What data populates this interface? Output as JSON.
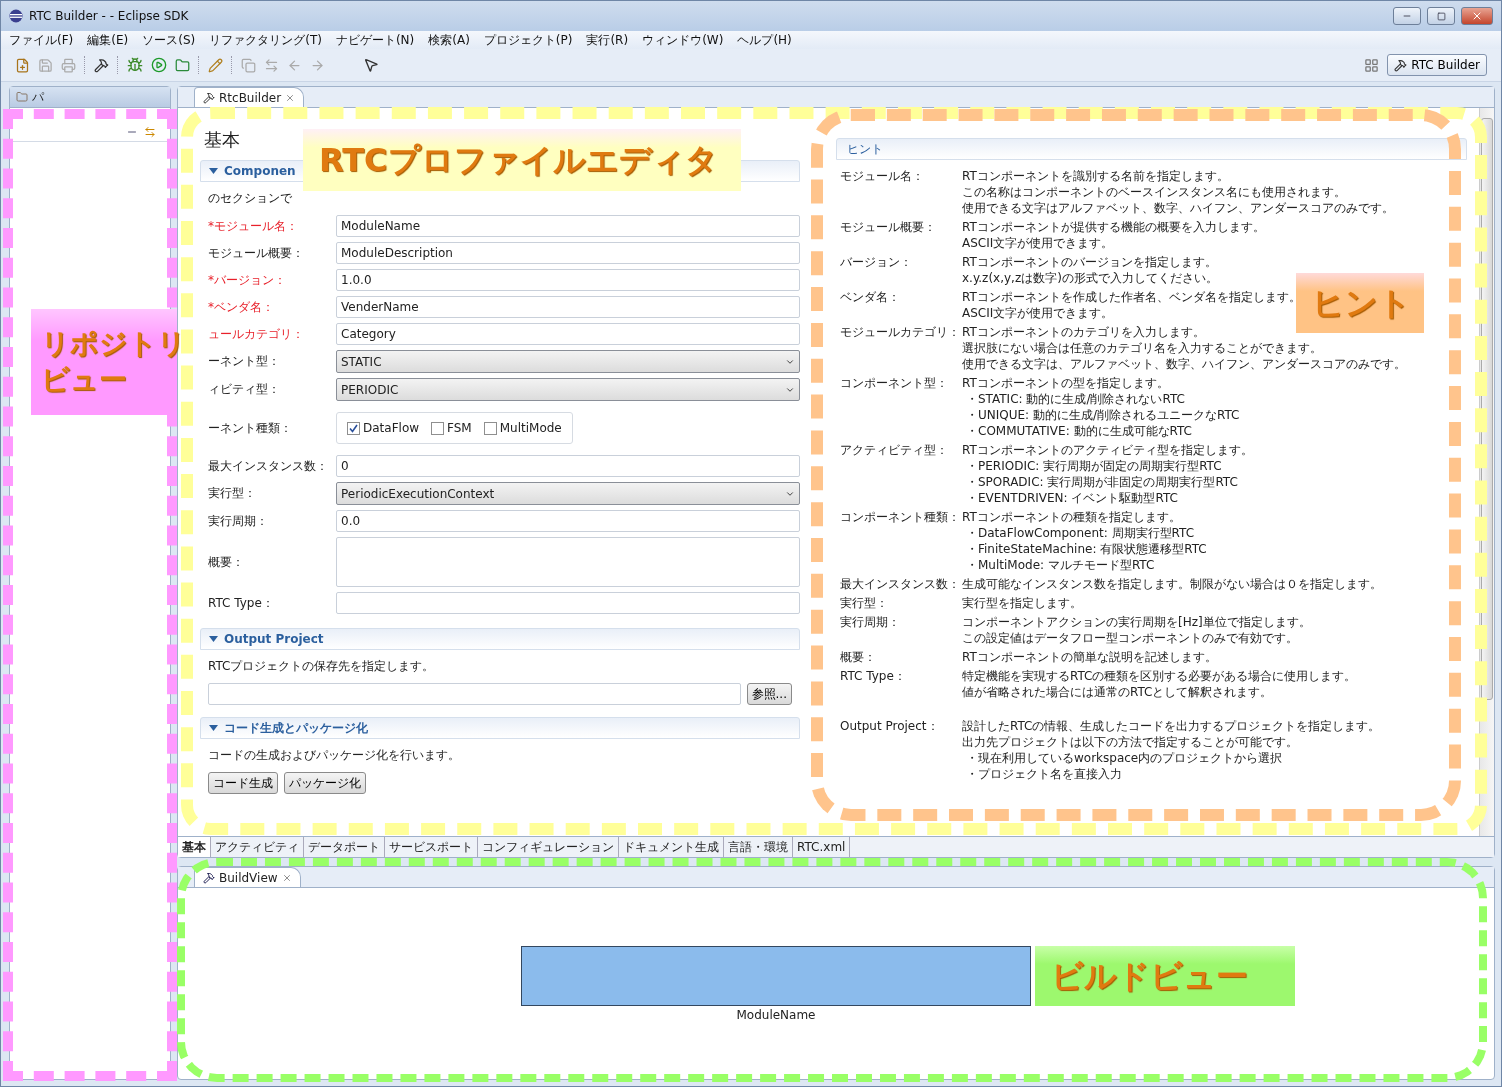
{
  "window": {
    "title": "RTC Builder -  - Eclipse SDK"
  },
  "menu": [
    "ファイル(F)",
    "編集(E)",
    "ソース(S)",
    "リファクタリング(T)",
    "ナビゲート(N)",
    "検索(A)",
    "プロジェクト(P)",
    "実行(R)",
    "ウィンドウ(W)",
    "ヘルプ(H)"
  ],
  "perspective": {
    "label": "RTC Builder"
  },
  "left_panel": {
    "tab": "パ"
  },
  "editor": {
    "tab": "RtcBuilder",
    "page_title": "基本",
    "basic_section": {
      "title": "Componen",
      "description": "のセクションで",
      "fields": [
        {
          "label": "*モジュール名：",
          "required": true,
          "kind": "text",
          "value": "ModuleName"
        },
        {
          "label": "モジュール概要：",
          "required": false,
          "kind": "text",
          "value": "ModuleDescription"
        },
        {
          "label": "*バージョン：",
          "required": true,
          "kind": "text",
          "value": "1.0.0"
        },
        {
          "label": "*ベンダ名：",
          "required": true,
          "kind": "text",
          "value": "VenderName"
        },
        {
          "label": "ュールカテゴリ：",
          "required": true,
          "kind": "text",
          "value": "Category"
        },
        {
          "label": "ーネント型：",
          "required": false,
          "kind": "combo",
          "value": "STATIC"
        },
        {
          "label": "ィビティ型：",
          "required": false,
          "kind": "combo",
          "value": "PERIODIC"
        },
        {
          "label": "ーネント種類：",
          "required": false,
          "kind": "checks",
          "options": [
            {
              "label": "DataFlow",
              "checked": true
            },
            {
              "label": "FSM",
              "checked": false
            },
            {
              "label": "MultiMode",
              "checked": false
            }
          ]
        },
        {
          "label": "最大インスタンス数：",
          "required": false,
          "kind": "text",
          "value": "0"
        },
        {
          "label": "実行型：",
          "required": false,
          "kind": "combo",
          "value": "PeriodicExecutionContext"
        },
        {
          "label": "実行周期：",
          "required": false,
          "kind": "text",
          "value": "0.0"
        },
        {
          "label": "概要：",
          "required": false,
          "kind": "textarea"
        },
        {
          "label": "RTC Type：",
          "required": false,
          "kind": "text"
        }
      ]
    },
    "output_section": {
      "title": "Output Project",
      "description": "RTCプロジェクトの保存先を指定します。",
      "browse_button": "参照..."
    },
    "codegen_section": {
      "title": "コード生成とパッケージ化",
      "description": "コードの生成およびパッケージ化を行います。",
      "buttons": [
        "コード生成",
        "パッケージ化"
      ]
    },
    "bottom_tabs": [
      {
        "label": "基本",
        "selected": true
      },
      {
        "label": "アクティビティ",
        "selected": false
      },
      {
        "label": "データポート",
        "selected": false
      },
      {
        "label": "サービスポート",
        "selected": false
      },
      {
        "label": "コンフィギュレーション",
        "selected": false
      },
      {
        "label": "ドキュメント生成",
        "selected": false
      },
      {
        "label": "言語・環境",
        "selected": false
      },
      {
        "label": "RTC.xml",
        "selected": false
      }
    ]
  },
  "hints": {
    "title": "ヒント",
    "items": [
      {
        "label": "モジュール名：",
        "lines": [
          "RTコンポーネントを識別する名前を指定します。",
          "この名称はコンポーネントのベースインスタンス名にも使用されます。",
          "使用できる文字はアルファベット、数字、ハイフン、アンダースコアのみです。"
        ]
      },
      {
        "label": "モジュール概要：",
        "lines": [
          "RTコンポーネントが提供する機能の概要を入力します。",
          "ASCII文字が使用できます。"
        ]
      },
      {
        "label": "バージョン：",
        "lines": [
          "RTコンポーネントのバージョンを指定します。",
          "x.y.z(x,y,zは数字)の形式で入力してください。"
        ]
      },
      {
        "label": "ベンダ名：",
        "lines": [
          "RTコンポーネントを作成した作者名、ベンダ名を指定します。",
          "ASCII文字が使用できます。"
        ]
      },
      {
        "label": "モジュールカテゴリ：",
        "lines": [
          "RTコンポーネントのカテゴリを入力します。",
          "選択肢にない場合は任意のカテゴリ名を入力することができます。",
          "使用できる文字は、アルファベット、数字、ハイフン、アンダースコアのみです。"
        ]
      },
      {
        "label": "コンポーネント型：",
        "lines": [
          "RTコンポーネントの型を指定します。",
          "・STATIC: 動的に生成/削除されないRTC",
          "・UNIQUE: 動的に生成/削除されるユニークなRTC",
          "・COMMUTATIVE: 動的に生成可能なRTC"
        ]
      },
      {
        "label": "アクティビティ型：",
        "lines": [
          "RTコンポーネントのアクティビティ型を指定します。",
          "・PERIODIC: 実行周期が固定の周期実行型RTC",
          "・SPORADIC: 実行周期が非固定の周期実行型RTC",
          "・EVENTDRIVEN: イベント駆動型RTC"
        ]
      },
      {
        "label": "コンポーネント種類：",
        "lines": [
          "RTコンポーネントの種類を指定します。",
          "・DataFlowComponent: 周期実行型RTC",
          "・FiniteStateMachine: 有限状態遷移型RTC",
          "・MultiMode: マルチモード型RTC"
        ]
      },
      {
        "label": "最大インスタンス数：",
        "lines": [
          "生成可能なインスタンス数を指定します。制限がない場合は０を指定します。"
        ]
      },
      {
        "label": "実行型：",
        "lines": [
          "実行型を指定します。"
        ]
      },
      {
        "label": "実行周期：",
        "lines": [
          "コンポーネントアクションの実行周期を[Hz]単位で指定します。",
          "この設定値はデータフロー型コンポーネントのみで有効です。"
        ]
      },
      {
        "label": "概要：",
        "lines": [
          "RTコンポーネントの簡単な説明を記述します。"
        ]
      },
      {
        "label": "RTC Type：",
        "lines": [
          "特定機能を実現するRTCの種類を区別する必要がある場合に使用します。",
          "値が省略された場合には通常のRTCとして解釈されます。"
        ]
      },
      {
        "label": "Output Project：",
        "lines": [
          "設計したRTCの情報、生成したコードを出力するプロジェクトを指定します。",
          "出力先プロジェクトは以下の方法で指定することが可能です。",
          "・現在利用しているworkspace内のプロジェクトから選択",
          "・プロジェクト名を直接入力"
        ]
      }
    ]
  },
  "build_view": {
    "tab": "BuildView",
    "component": "ModuleName"
  },
  "callouts": [
    {
      "kind": "editor",
      "lines": [
        "RTCプロファイルエディタ"
      ]
    },
    {
      "kind": "repository",
      "lines": [
        "リポジトリ",
        "ビュー"
      ]
    },
    {
      "kind": "hint",
      "lines": [
        "ヒント"
      ]
    },
    {
      "kind": "build",
      "lines": [
        "ビルドビュー"
      ]
    }
  ]
}
